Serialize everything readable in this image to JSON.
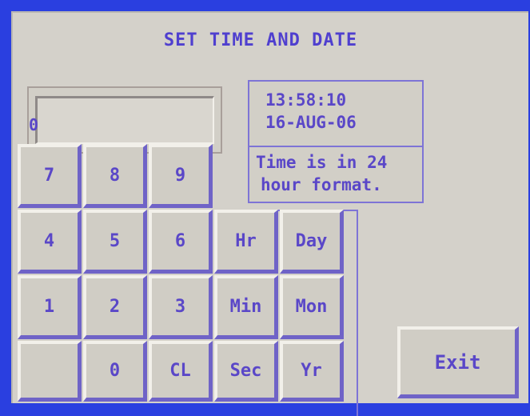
{
  "screen": {
    "title": "SET TIME AND DATE"
  },
  "entry": {
    "value": "0"
  },
  "info": {
    "time": "13:58:10",
    "date": "16-AUG-06",
    "note_line1": "Time is in 24",
    "note_line2": "hour format."
  },
  "keypad": {
    "k7": "7",
    "k8": "8",
    "k9": "9",
    "k4": "4",
    "k5": "5",
    "k6": "6",
    "k1": "1",
    "k2": "2",
    "k3": "3",
    "k0": "0",
    "clear": "CL"
  },
  "fields": {
    "hour": "Hr",
    "day": "Day",
    "minute": "Min",
    "month": "Mon",
    "second": "Sec",
    "year": "Yr"
  },
  "exit": {
    "label": "Exit"
  },
  "colors": {
    "frame": "#2a3fe0",
    "panel": "#d4d1ca",
    "text": "#5a47c8"
  }
}
